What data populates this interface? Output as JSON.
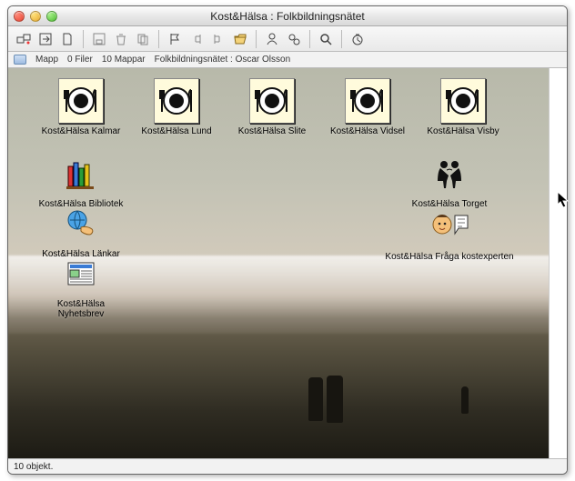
{
  "window": {
    "title": "Kost&Hälsa : Folkbildningsnätet"
  },
  "infobar": {
    "type": "Mapp",
    "files": "0 Filer",
    "folders": "10 Mappar",
    "path": "Folkbildningsnätet : Oscar Olsson"
  },
  "icons": {
    "row1": [
      {
        "label": "Kost&Hälsa Kalmar"
      },
      {
        "label": "Kost&Hälsa Lund"
      },
      {
        "label": "Kost&Hälsa Slite"
      },
      {
        "label": "Kost&Hälsa Vidsel"
      },
      {
        "label": "Kost&Hälsa Visby"
      }
    ],
    "bibliotek": {
      "label": "Kost&Hälsa Bibliotek"
    },
    "lankar": {
      "label": "Kost&Hälsa Länkar"
    },
    "nyhetsbrev": {
      "label": "Kost&Hälsa Nyhetsbrev"
    },
    "torget": {
      "label": "Kost&Hälsa Torget"
    },
    "fraga": {
      "label": "Kost&Hälsa Fråga kostexperten"
    }
  },
  "status": {
    "text": "10 objekt."
  }
}
